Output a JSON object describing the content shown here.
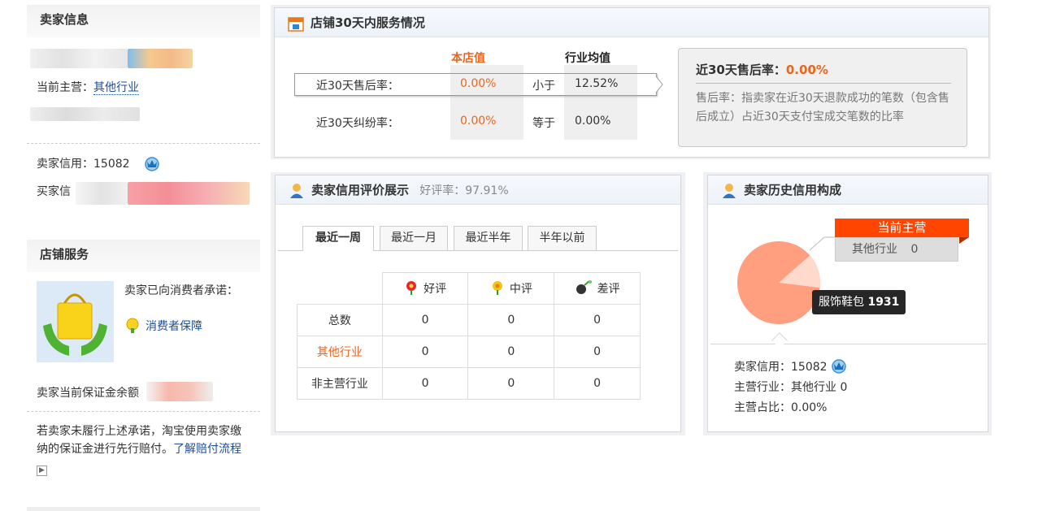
{
  "sidebar": {
    "seller_info_title": "卖家信息",
    "main_business_label": "当前主营：",
    "main_business_value": "其他行业",
    "seller_credit_label": "卖家信用：",
    "seller_credit_value": "15082",
    "buyer_credit_label": "买家信",
    "shop_service_title": "店铺服务",
    "promise_text": "卖家已向消费者承诺：",
    "consumer_protection": "消费者保障",
    "deposit_label": "卖家当前保证金余额",
    "notice_text": "若卖家未履行上述承诺，淘宝使用卖家缴纳的保证金进行先行赔付。",
    "notice_link": "了解赔付流程"
  },
  "service_panel": {
    "title": "店铺30天内服务情况",
    "col_shop": "本店值",
    "col_industry": "行业均值",
    "rows": [
      {
        "label": "近30天售后率：",
        "shop": "0.00%",
        "compare": "小于",
        "industry": "12.52%"
      },
      {
        "label": "近30天纠纷率：",
        "shop": "0.00%",
        "compare": "等于",
        "industry": "0.00%"
      }
    ],
    "tip_title": "近30天售后率：",
    "tip_value": "0.00%",
    "tip_desc": "售后率：指卖家在近30天退款成功的笔数（包含售后成立）占近30天支付宝成交笔数的比率"
  },
  "rating_panel": {
    "title": "卖家信用评价展示",
    "rate_label": "好评率：",
    "rate_value": "97.91%",
    "tabs": [
      "最近一周",
      "最近一月",
      "最近半年",
      "半年以前"
    ],
    "headers": [
      "好评",
      "中评",
      "差评"
    ],
    "rows": [
      {
        "label": "总数",
        "values": [
          "0",
          "0",
          "0"
        ]
      },
      {
        "label": "其他行业",
        "values": [
          "0",
          "0",
          "0"
        ]
      },
      {
        "label": "非主营行业",
        "values": [
          "0",
          "0",
          "0"
        ]
      }
    ]
  },
  "history_panel": {
    "title": "卖家历史信用构成",
    "legend_title": "当前主营",
    "legend_item": "其他行业",
    "legend_value": "0",
    "tooltip_label": "服饰鞋包",
    "tooltip_value": "1931",
    "credit_label": "卖家信用：",
    "credit_value": "15082",
    "main_label": "主营行业：",
    "main_value": "其他行业 0",
    "ratio_label": "主营占比：",
    "ratio_value": "0.00%"
  },
  "chart_data": {
    "type": "pie",
    "slices": [
      {
        "label": "服饰鞋包",
        "value": 1931
      },
      {
        "label": "其他行业",
        "value": 0
      }
    ]
  }
}
